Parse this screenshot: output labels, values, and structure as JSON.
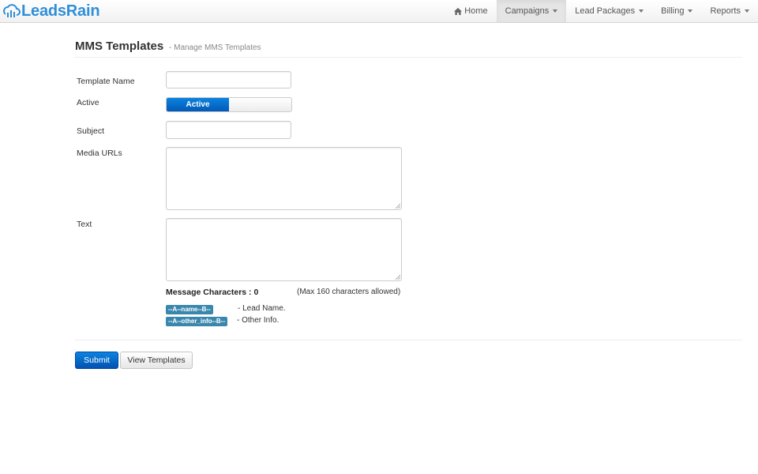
{
  "brand": {
    "name": "LeadsRain"
  },
  "nav": {
    "items": [
      {
        "label": "Home",
        "icon": "home-icon",
        "active": false,
        "dropdown": false
      },
      {
        "label": "Campaigns",
        "active": true,
        "dropdown": true
      },
      {
        "label": "Lead Packages",
        "active": false,
        "dropdown": true
      },
      {
        "label": "Billing",
        "active": false,
        "dropdown": true
      },
      {
        "label": "Reports",
        "active": false,
        "dropdown": true
      }
    ]
  },
  "header": {
    "title": "MMS Templates",
    "subtitle": "- Manage MMS Templates"
  },
  "form": {
    "template_name": {
      "label": "Template Name",
      "value": ""
    },
    "active": {
      "label": "Active",
      "toggle_on_label": "Active",
      "state": "on"
    },
    "subject": {
      "label": "Subject",
      "value": ""
    },
    "media_urls": {
      "label": "Media URLs",
      "value": ""
    },
    "text": {
      "label": "Text",
      "value": ""
    },
    "message_characters": "Message Characters : 0",
    "max_characters": "(Max 160 characters allowed)",
    "placeholders": [
      {
        "tag": "--A--name--B--",
        "description": "- Lead Name."
      },
      {
        "tag": "--A--other_info--B--",
        "description": "- Other Info."
      }
    ]
  },
  "actions": {
    "submit_label": "Submit",
    "view_templates_label": "View Templates"
  },
  "colors": {
    "brand": "#2f8fd8",
    "primary": "#0a84e0",
    "tag": "#3a87ad"
  }
}
